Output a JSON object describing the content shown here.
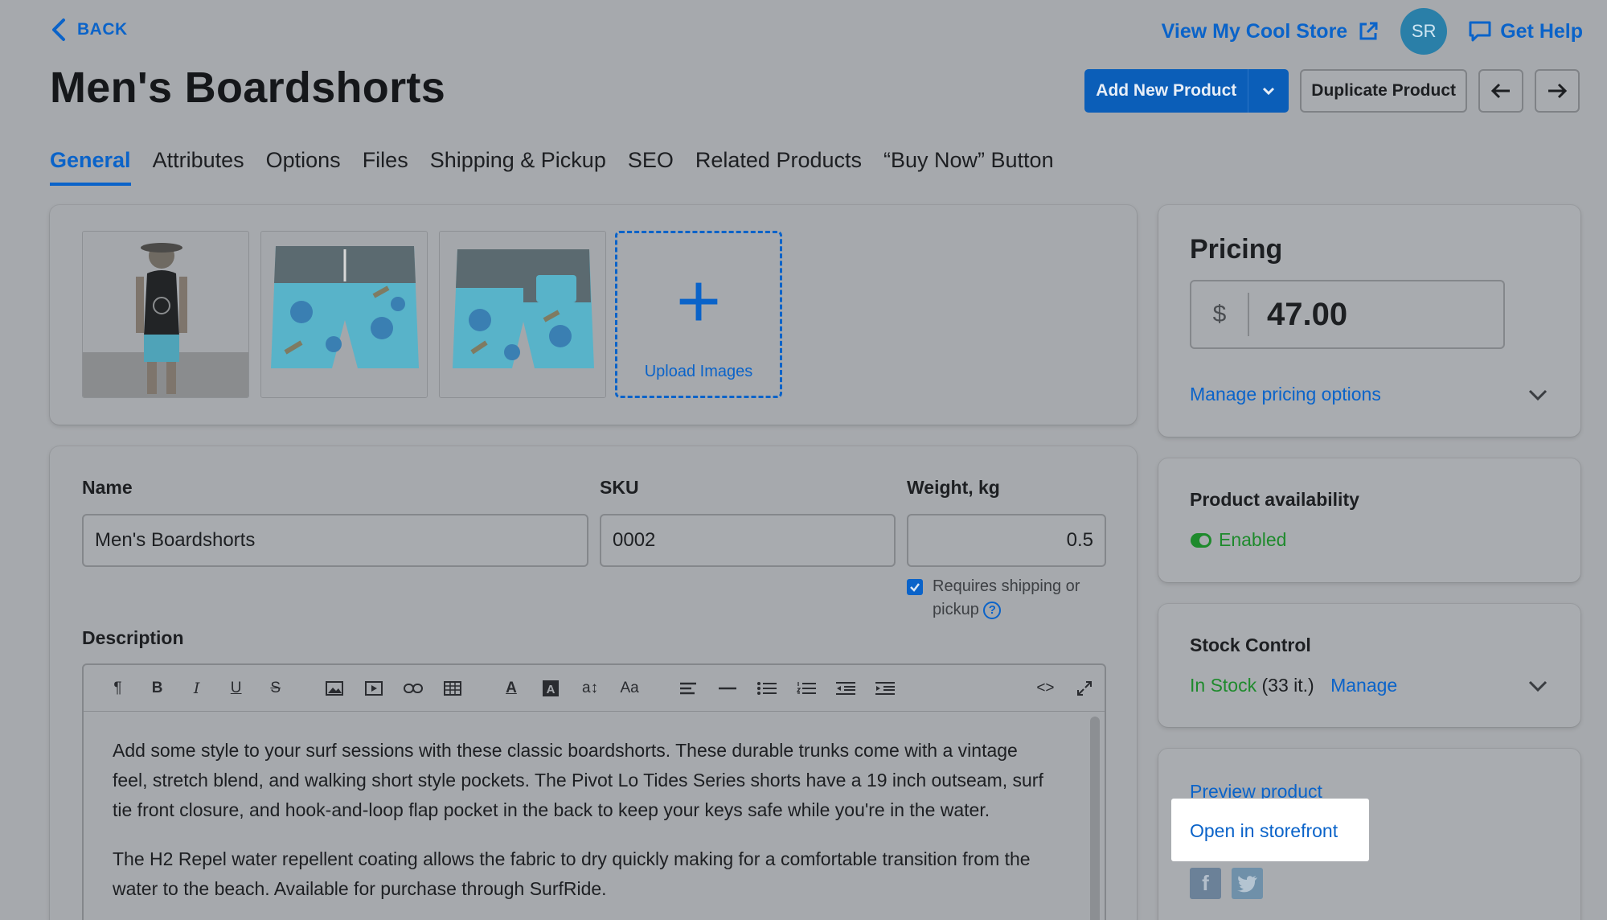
{
  "header": {
    "back_label": "BACK",
    "page_title": "Men's Boardshorts",
    "store_link": "View My Cool Store",
    "avatar_initials": "SR",
    "help_label": "Get Help"
  },
  "actions": {
    "add_new": "Add New Product",
    "duplicate": "Duplicate Product"
  },
  "tabs": [
    {
      "label": "General",
      "active": true
    },
    {
      "label": "Attributes"
    },
    {
      "label": "Options"
    },
    {
      "label": "Files"
    },
    {
      "label": "Shipping & Pickup"
    },
    {
      "label": "SEO"
    },
    {
      "label": "Related Products"
    },
    {
      "label": "“Buy Now” Button"
    }
  ],
  "images": {
    "upload_label": "Upload Images"
  },
  "form": {
    "name_label": "Name",
    "name_value": "Men's Boardshorts",
    "sku_label": "SKU",
    "sku_value": "0002",
    "weight_label": "Weight, kg",
    "weight_value": "0.5",
    "requires_shipping": "Requires shipping or",
    "requires_shipping_2": "pickup",
    "description_label": "Description",
    "toolbar_icons": [
      "paragraph-icon",
      "bold-icon",
      "italic-icon",
      "underline-icon",
      "strikethrough-icon",
      "image-icon",
      "video-icon",
      "link-icon",
      "table-icon",
      "font-color-icon",
      "background-color-icon",
      "font-size-icon",
      "font-family-icon",
      "align-icon",
      "horizontal-rule-icon",
      "bullet-list-icon",
      "numbered-list-icon",
      "outdent-icon",
      "indent-icon",
      "code-view-icon",
      "fullscreen-icon"
    ],
    "description_p1": "Add some style to your surf sessions with these classic boardshorts. These durable trunks come with a vintage feel, stretch blend, and walking short style pockets. The Pivot Lo Tides Series shorts have a 19 inch outseam, surf tie front closure, and hook-and-loop flap pocket in the back to keep your keys safe while you're in the water.",
    "description_p2": "The H2 Repel water repellent coating allows the fabric to dry quickly making for a comfortable transition from the water to the beach. Available for purchase through SurfRide."
  },
  "pricing": {
    "title": "Pricing",
    "currency": "$",
    "price": "47.00",
    "manage_label": "Manage pricing options"
  },
  "availability": {
    "title": "Product availability",
    "status": "Enabled"
  },
  "stock": {
    "title": "Stock Control",
    "status": "In Stock",
    "count": "(33 it.)",
    "manage": "Manage"
  },
  "links": {
    "preview": "Preview product",
    "open_storefront": "Open in storefront"
  },
  "colors": {
    "accent": "#0a63c9",
    "success": "#1e8a2c",
    "overlay_bg": "#a6a9ad"
  }
}
